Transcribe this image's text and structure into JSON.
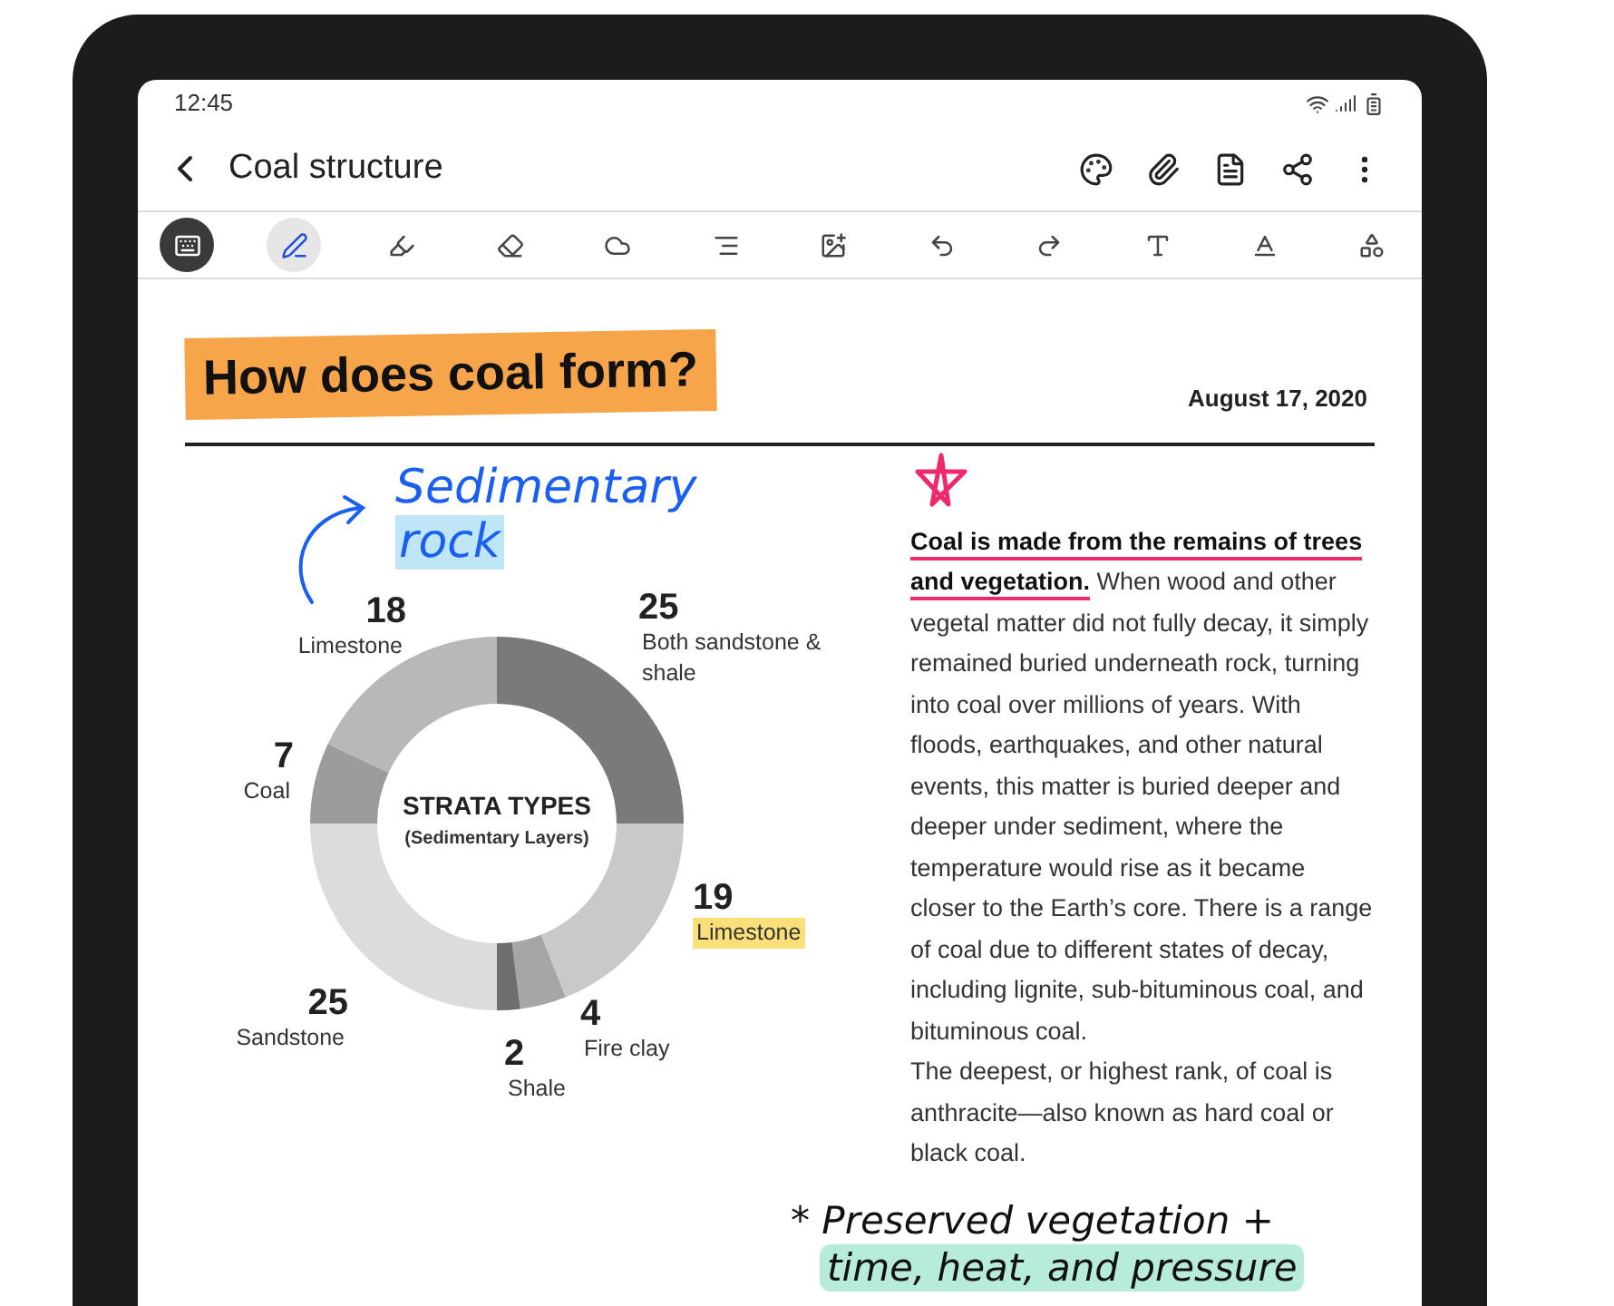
{
  "status_bar": {
    "time": "12:45"
  },
  "app_bar": {
    "title": "Coal structure"
  },
  "toolbar": {
    "tools": [
      {
        "kind": "keyboard",
        "selected": true
      },
      {
        "kind": "pen",
        "selected": true
      },
      {
        "kind": "highlighter",
        "selected": false
      },
      {
        "kind": "eraser",
        "selected": false
      },
      {
        "kind": "lasso",
        "selected": false
      },
      {
        "kind": "text-align",
        "selected": false
      },
      {
        "kind": "image-text",
        "selected": false
      },
      {
        "kind": "undo",
        "selected": false
      },
      {
        "kind": "redo",
        "selected": false
      },
      {
        "kind": "text-style",
        "selected": false
      },
      {
        "kind": "text-format",
        "selected": false
      },
      {
        "kind": "shapes",
        "selected": false
      }
    ]
  },
  "note": {
    "heading": "How does coal form?",
    "date": "August 17, 2020",
    "annotation": {
      "line_1": "Sedimentary",
      "line_2": "rock"
    },
    "chart": {
      "subtitle": "(Sedimentary Layers)",
      "chart_data": {
        "type": "donut",
        "title": "STRATA TYPES",
        "categories": [
          "Both sandstone & shale",
          "Limestone",
          "Fire clay",
          "Shale",
          "Sandstone",
          "Coal",
          "Limestone"
        ],
        "values": [
          25,
          19,
          4,
          2,
          25,
          7,
          18
        ],
        "data_labels": true
      },
      "label_highlight": {
        "color": "#fbe07a"
      },
      "labels": [
        {
          "highlighted": false
        },
        {
          "highlighted": true
        },
        {
          "highlighted": false
        },
        {
          "highlighted": false
        },
        {
          "highlighted": false
        },
        {
          "highlighted": false
        },
        {
          "highlighted": false
        }
      ]
    },
    "paragraphs": [
      "**Coal is made from the remains of trees and vegetation.** When wood and other vegetal matter did not fully decay, it simply remained buried underneath rock, turning into coal over millions of years. With floods, earthquakes, and other natural events, this matter is buried deeper and deeper under sediment, where the temperature would rise as it became closer to the Earth’s core. There is a range of coal due to different states of decay, including lignite, sub-bituminous coal, and bituminous coal.",
      "The deepest, or highest rank, of coal is anthracite—also known as hard coal or black coal."
    ],
    "handwriting": {
      "line_1": "* Preserved vegetation +",
      "line_2": "time, heat, and pressure"
    }
  }
}
